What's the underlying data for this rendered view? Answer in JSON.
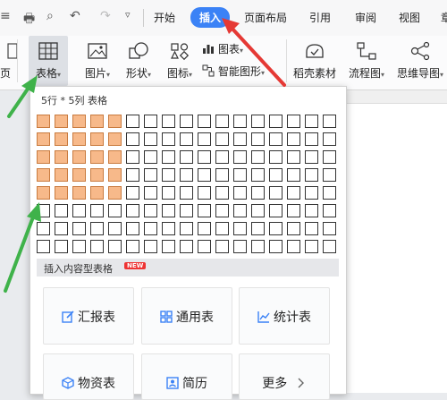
{
  "quick_access": {
    "menu_glyph": "≡",
    "print_glyph": "🖶",
    "preview_glyph": "⌕",
    "undo_glyph": "↶",
    "redo_glyph": "↷",
    "more_glyph": "▿"
  },
  "tabs": [
    {
      "label": "开始"
    },
    {
      "label": "插入"
    },
    {
      "label": "页面布局"
    },
    {
      "label": "引用"
    },
    {
      "label": "审阅"
    },
    {
      "label": "视图"
    },
    {
      "label": "章"
    }
  ],
  "toolbar": {
    "page_partial_label": "页",
    "table_label": "表格",
    "picture_label": "图片",
    "shape_label": "形状",
    "icon_label": "图标",
    "chart_label": "图表",
    "smartart_label": "智能图形",
    "shell_label": "稻壳素材",
    "flowchart_label": "流程图",
    "mindmap_label": "思维导图",
    "dropdown_glyph": "▾"
  },
  "table_panel": {
    "title": "5行 * 5列 表格",
    "grid_rows": 8,
    "grid_cols": 17,
    "selected_rows": 5,
    "selected_cols": 5,
    "content_section_title": "插入内容型表格",
    "new_badge": "NEW",
    "cards": [
      {
        "label": "汇报表",
        "icon": "edit-icon"
      },
      {
        "label": "通用表",
        "icon": "grid-icon"
      },
      {
        "label": "统计表",
        "icon": "chart-line-icon"
      },
      {
        "label": "物资表",
        "icon": "box-icon"
      },
      {
        "label": "简历",
        "icon": "person-icon"
      },
      {
        "label": "更多",
        "icon": "chevron-right-icon"
      }
    ]
  },
  "colors": {
    "accent": "#3b82f6",
    "selected_cell": "#f7b98a",
    "annotation_red": "#e53935",
    "annotation_green": "#3fb24a"
  }
}
